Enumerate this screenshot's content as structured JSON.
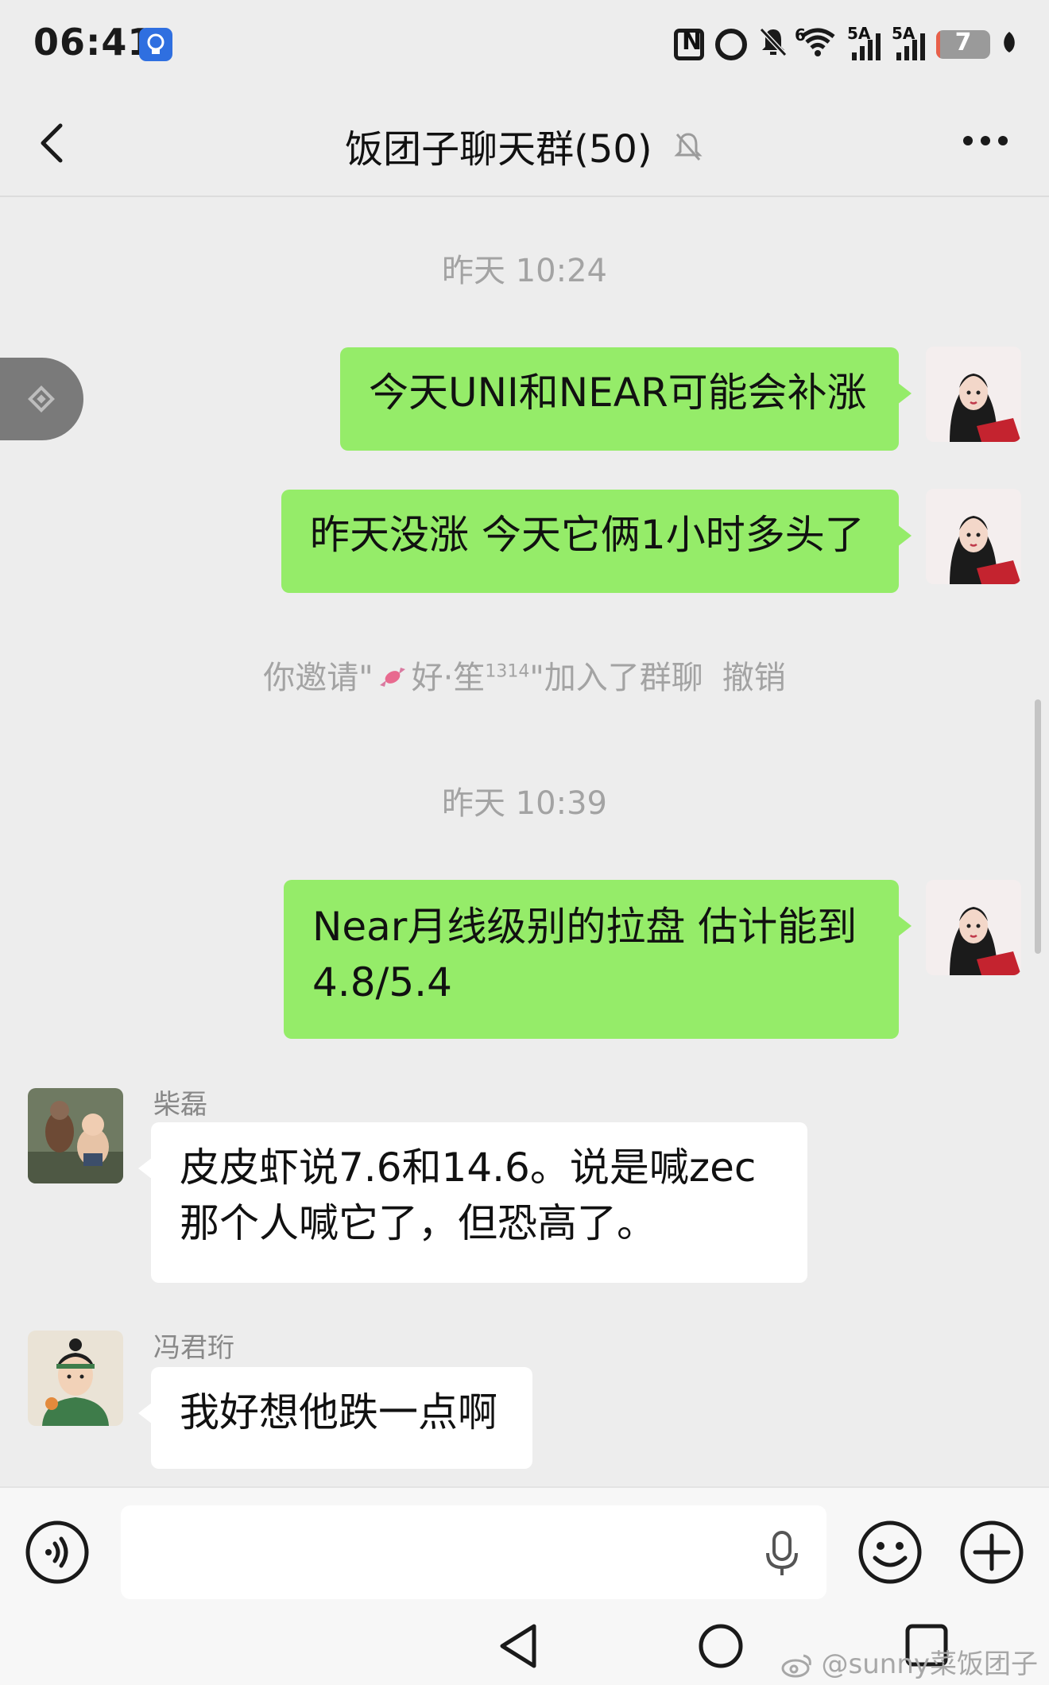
{
  "status_bar": {
    "time": "06:41",
    "battery_level": "7",
    "battery_fraction": 0.07,
    "signal_labels": [
      "5A",
      "5A"
    ],
    "wifi_label": "6",
    "icons": [
      "light-bulb-icon",
      "nfc-icon",
      "alarm-icon",
      "mute-icon",
      "wifi-icon",
      "signal-icon",
      "signal-icon",
      "battery-icon",
      "leaf-icon"
    ]
  },
  "header": {
    "title": "饭团子聊天群(50)",
    "back_icon": "chevron-left-icon",
    "muted_icon": "bell-off-icon",
    "more_icon": "more-dots-icon"
  },
  "messages": {
    "time_1": "昨天 10:24",
    "out_1": "今天UNI和NEAR可能会补涨",
    "out_2": "昨天没涨 今天它俩1小时多头了",
    "system_prefix": "你邀请\"",
    "system_name": "好·笙",
    "system_name_sup": "1314",
    "system_suffix": "\"加入了群聊",
    "system_revoke": "撤销",
    "time_2": "昨天 10:39",
    "out_3": "Near月线级别的拉盘  估计能到4.8/5.4",
    "in_1_sender": "柴磊",
    "in_1_text": "皮皮虾说7.6和14.6。说是喊zec那个人喊它了，但恐高了。",
    "in_2_sender": "冯君珩",
    "in_2_text": "我好想他跌一点啊"
  },
  "input_bar": {
    "voice_icon": "voice-icon",
    "mic_icon": "microphone-icon",
    "emoji_icon": "emoji-icon",
    "plus_icon": "plus-icon",
    "value": ""
  },
  "nav": {
    "watermark": "@sunny菜饭团子"
  },
  "colors": {
    "background": "#ededed",
    "outgoing_bubble": "#95ec69",
    "incoming_bubble": "#ffffff",
    "system_text": "#a3a3a3"
  }
}
